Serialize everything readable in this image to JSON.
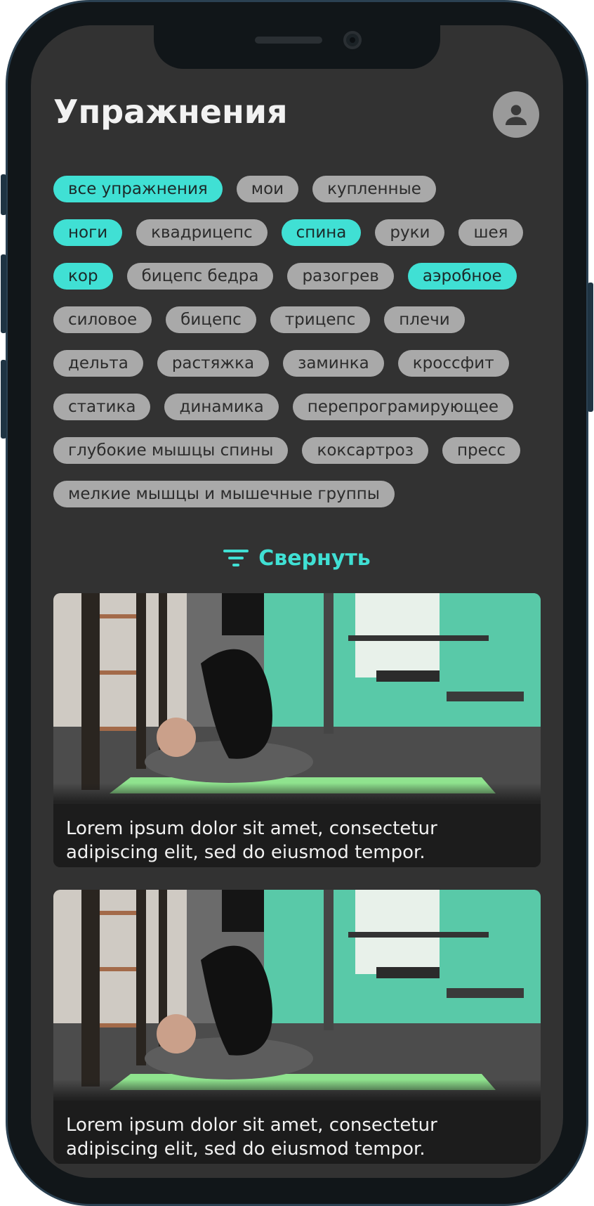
{
  "header": {
    "title": "Упражнения"
  },
  "filters": {
    "rows": [
      [
        {
          "label": "все упражнения",
          "active": true
        },
        {
          "label": "мои",
          "active": false
        },
        {
          "label": "купленные",
          "active": false
        }
      ],
      [
        {
          "label": "ноги",
          "active": true
        },
        {
          "label": "квадрицепс",
          "active": false
        },
        {
          "label": "спина",
          "active": true
        },
        {
          "label": "руки",
          "active": false
        },
        {
          "label": "шея",
          "active": false
        }
      ],
      [
        {
          "label": "кор",
          "active": true
        },
        {
          "label": "бицепс бедра",
          "active": false
        },
        {
          "label": "разогрев",
          "active": false
        },
        {
          "label": "аэробное",
          "active": true
        }
      ],
      [
        {
          "label": "силовое",
          "active": false
        },
        {
          "label": "бицепс",
          "active": false
        },
        {
          "label": "трицепс",
          "active": false
        },
        {
          "label": "плечи",
          "active": false
        }
      ],
      [
        {
          "label": "дельта",
          "active": false
        },
        {
          "label": "растяжка",
          "active": false
        },
        {
          "label": "заминка",
          "active": false
        },
        {
          "label": "кроссфит",
          "active": false
        }
      ],
      [
        {
          "label": "статика",
          "active": false
        },
        {
          "label": "динамика",
          "active": false
        },
        {
          "label": "перепрограмирующее",
          "active": false
        }
      ],
      [
        {
          "label": "глубокие мышцы спины",
          "active": false
        },
        {
          "label": "коксартроз",
          "active": false
        },
        {
          "label": "пресс",
          "active": false
        }
      ],
      [
        {
          "label": "мелкие мышцы и мышечные группы",
          "active": false
        }
      ]
    ],
    "collapse_label": "Свернуть",
    "collapse_icon": "filter-lines-icon"
  },
  "cards": [
    {
      "caption": "Lorem ipsum dolor sit amet, consectetur adipiscing elit, sed do eiusmod tempor."
    },
    {
      "caption": "Lorem ipsum dolor sit amet, consectetur adipiscing elit, sed do eiusmod tempor."
    }
  ],
  "colors": {
    "accent": "#40e0d4",
    "background": "#323232",
    "chip": "#a9a9a9",
    "card": "#1c1c1c"
  },
  "icons": {
    "avatar": "user-avatar-icon"
  }
}
